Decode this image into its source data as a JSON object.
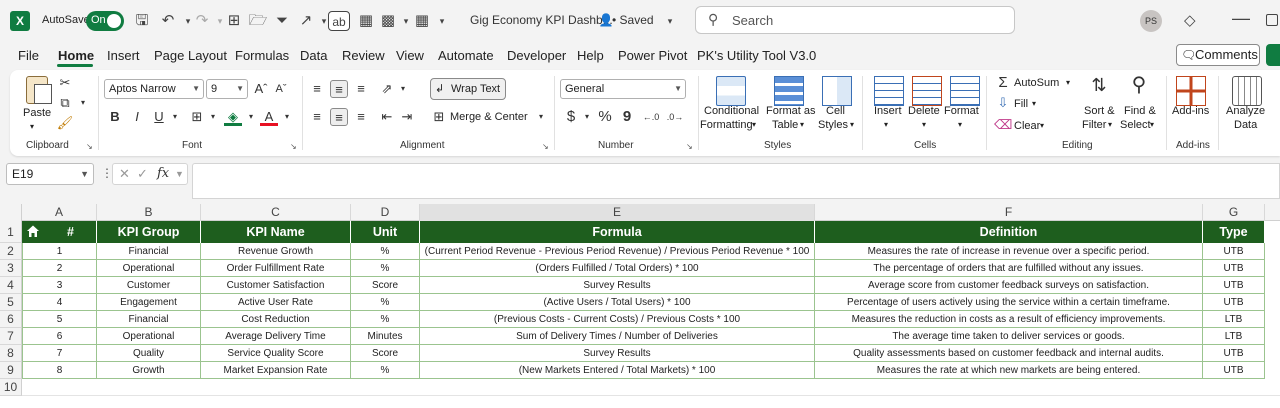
{
  "titlebar": {
    "app_logo": "X",
    "autosave_label": "AutoSave",
    "autosave_state": "On",
    "doc_title": "Gig Economy KPI Dashb...",
    "saved_status": "• Saved",
    "search_placeholder": "Search",
    "avatar_initials": "PS"
  },
  "menu": {
    "items": [
      "File",
      "Home",
      "Insert",
      "Page Layout",
      "Formulas",
      "Data",
      "Review",
      "View",
      "Automate",
      "Developer",
      "Help",
      "Power Pivot",
      "PK's Utility Tool V3.0"
    ],
    "active": "Home",
    "comments_label": "Comments"
  },
  "ribbon": {
    "clipboard": {
      "paste_label": "Paste",
      "group_label": "Clipboard"
    },
    "font": {
      "font_name": "Aptos Narrow",
      "font_size": "9",
      "bold": "B",
      "italic": "I",
      "underline": "U",
      "group_label": "Font"
    },
    "alignment": {
      "wrap_text": "Wrap Text",
      "merge_center": "Merge & Center",
      "group_label": "Alignment"
    },
    "number": {
      "format": "General",
      "currency": "$",
      "percent": "%",
      "comma": "9",
      "group_label": "Number"
    },
    "styles": {
      "conditional_formatting": "Conditional",
      "conditional_formatting2": "Formatting",
      "format_as_table": "Format as",
      "format_as_table2": "Table",
      "cell_styles": "Cell",
      "cell_styles2": "Styles",
      "group_label": "Styles"
    },
    "cells": {
      "insert": "Insert",
      "delete": "Delete",
      "format": "Format",
      "group_label": "Cells"
    },
    "editing": {
      "autosum": "AutoSum",
      "fill": "Fill",
      "clear": "Clear",
      "sort_filter": "Sort &",
      "sort_filter2": "Filter",
      "find_select": "Find &",
      "find_select2": "Select",
      "group_label": "Editing"
    },
    "addins": {
      "addins": "Add-ins",
      "group_label": "Add-ins"
    },
    "analyze": {
      "label": "Analyze",
      "label2": "Data"
    }
  },
  "formula_bar": {
    "name_box": "E19",
    "fx": "fx",
    "value": ""
  },
  "grid": {
    "columns": [
      "A",
      "B",
      "C",
      "D",
      "E",
      "F",
      "G"
    ],
    "selected_column": "E",
    "row_numbers": [
      "1",
      "2",
      "3",
      "4",
      "5",
      "6",
      "7",
      "8",
      "9",
      "10"
    ],
    "headers": [
      "#",
      "KPI Group",
      "KPI Name",
      "Unit",
      "Formula",
      "Definition",
      "Type"
    ],
    "rows": [
      [
        "1",
        "Financial",
        "Revenue Growth",
        "%",
        "(Current Period Revenue - Previous Period Revenue) / Previous Period Revenue * 100",
        "Measures the rate of increase in revenue over a specific period.",
        "UTB"
      ],
      [
        "2",
        "Operational",
        "Order Fulfillment Rate",
        "%",
        "(Orders Fulfilled / Total Orders) * 100",
        "The percentage of orders that are fulfilled without any issues.",
        "UTB"
      ],
      [
        "3",
        "Customer",
        "Customer Satisfaction",
        "Score",
        "Survey Results",
        "Average score from customer feedback surveys on satisfaction.",
        "UTB"
      ],
      [
        "4",
        "Engagement",
        "Active User Rate",
        "%",
        "(Active Users / Total Users) * 100",
        "Percentage of users actively using the service within a certain timeframe.",
        "UTB"
      ],
      [
        "5",
        "Financial",
        "Cost Reduction",
        "%",
        "(Previous Costs - Current Costs) / Previous Costs * 100",
        "Measures the reduction in costs as a result of efficiency improvements.",
        "LTB"
      ],
      [
        "6",
        "Operational",
        "Average Delivery Time",
        "Minutes",
        "Sum of Delivery Times / Number of Deliveries",
        "The average time taken to deliver services or goods.",
        "LTB"
      ],
      [
        "7",
        "Quality",
        "Service Quality Score",
        "Score",
        "Survey Results",
        "Quality assessments based on customer feedback and internal audits.",
        "UTB"
      ],
      [
        "8",
        "Growth",
        "Market Expansion Rate",
        "%",
        "(New Markets Entered / Total Markets) * 100",
        "Measures the rate at which new markets are being entered.",
        "UTB"
      ]
    ]
  },
  "colors": {
    "header_fill": "#1e5e1e",
    "border": "#9bc48f",
    "brand": "#107c41"
  }
}
